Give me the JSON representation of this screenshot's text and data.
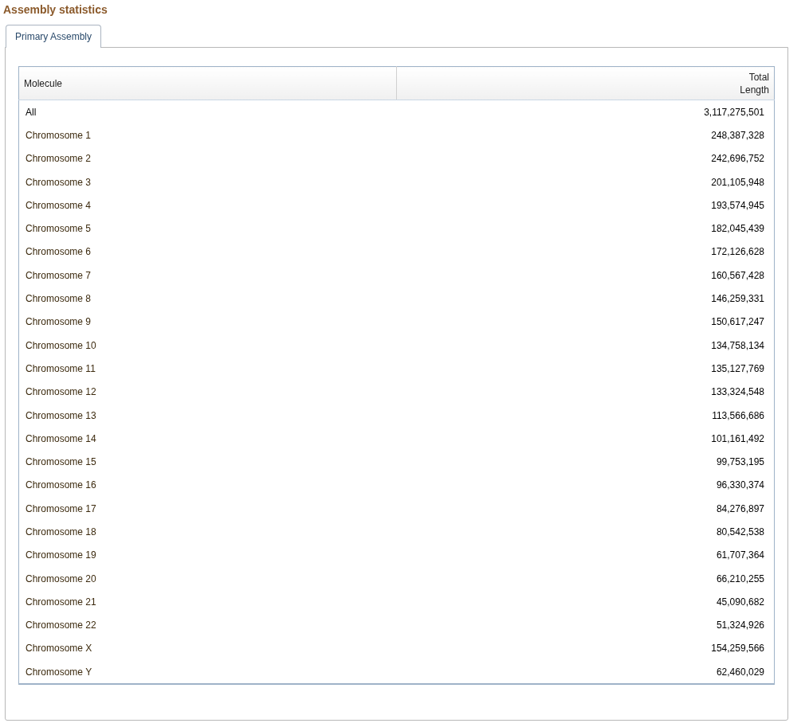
{
  "heading": "Assembly statistics",
  "tabs": [
    {
      "label": "Primary Assembly",
      "selected": true
    }
  ],
  "table": {
    "columns": [
      "Molecule",
      "Total\nLength"
    ],
    "rows": [
      {
        "molecule": "All",
        "link": false,
        "total_length": "3,117,275,501"
      },
      {
        "molecule": "Chromosome 1",
        "link": true,
        "total_length": "248,387,328"
      },
      {
        "molecule": "Chromosome 2",
        "link": true,
        "total_length": "242,696,752"
      },
      {
        "molecule": "Chromosome 3",
        "link": true,
        "total_length": "201,105,948"
      },
      {
        "molecule": "Chromosome 4",
        "link": true,
        "total_length": "193,574,945"
      },
      {
        "molecule": "Chromosome 5",
        "link": true,
        "total_length": "182,045,439"
      },
      {
        "molecule": "Chromosome 6",
        "link": true,
        "total_length": "172,126,628"
      },
      {
        "molecule": "Chromosome 7",
        "link": true,
        "total_length": "160,567,428"
      },
      {
        "molecule": "Chromosome 8",
        "link": true,
        "total_length": "146,259,331"
      },
      {
        "molecule": "Chromosome 9",
        "link": true,
        "total_length": "150,617,247"
      },
      {
        "molecule": "Chromosome 10",
        "link": true,
        "total_length": "134,758,134"
      },
      {
        "molecule": "Chromosome 11",
        "link": true,
        "total_length": "135,127,769"
      },
      {
        "molecule": "Chromosome 12",
        "link": true,
        "total_length": "133,324,548"
      },
      {
        "molecule": "Chromosome 13",
        "link": true,
        "total_length": "113,566,686"
      },
      {
        "molecule": "Chromosome 14",
        "link": true,
        "total_length": "101,161,492"
      },
      {
        "molecule": "Chromosome 15",
        "link": true,
        "total_length": "99,753,195"
      },
      {
        "molecule": "Chromosome 16",
        "link": true,
        "total_length": "96,330,374"
      },
      {
        "molecule": "Chromosome 17",
        "link": true,
        "total_length": "84,276,897"
      },
      {
        "molecule": "Chromosome 18",
        "link": true,
        "total_length": "80,542,538"
      },
      {
        "molecule": "Chromosome 19",
        "link": true,
        "total_length": "61,707,364"
      },
      {
        "molecule": "Chromosome 20",
        "link": true,
        "total_length": "66,210,255"
      },
      {
        "molecule": "Chromosome 21",
        "link": true,
        "total_length": "45,090,682"
      },
      {
        "molecule": "Chromosome 22",
        "link": true,
        "total_length": "51,324,926"
      },
      {
        "molecule": "Chromosome X",
        "link": true,
        "total_length": "154,259,566"
      },
      {
        "molecule": "Chromosome Y",
        "link": true,
        "total_length": "62,460,029"
      }
    ]
  }
}
